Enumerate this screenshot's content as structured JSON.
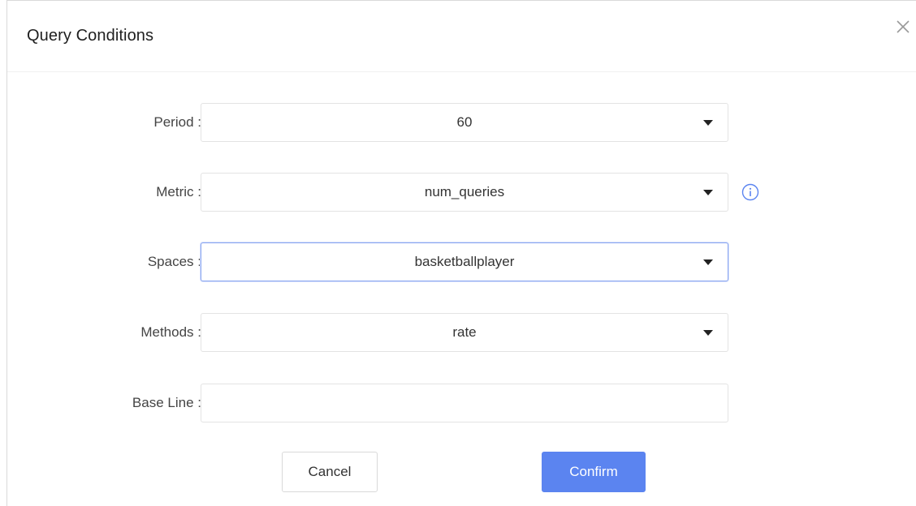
{
  "dialog": {
    "title": "Query Conditions",
    "close_icon": "close-icon"
  },
  "form": {
    "period": {
      "label": "Period",
      "value": "60"
    },
    "metric": {
      "label": "Metric",
      "value": "num_queries",
      "info_icon": "info-icon"
    },
    "spaces": {
      "label": "Spaces",
      "value": "basketballplayer"
    },
    "methods": {
      "label": "Methods",
      "value": "rate"
    },
    "baseline": {
      "label": "Base Line",
      "value": ""
    },
    "label_suffix": ":"
  },
  "buttons": {
    "cancel_label": "Cancel",
    "confirm_label": "Confirm"
  },
  "colors": {
    "accent": "#5b84f0",
    "focus_border": "#8aa5f0"
  }
}
